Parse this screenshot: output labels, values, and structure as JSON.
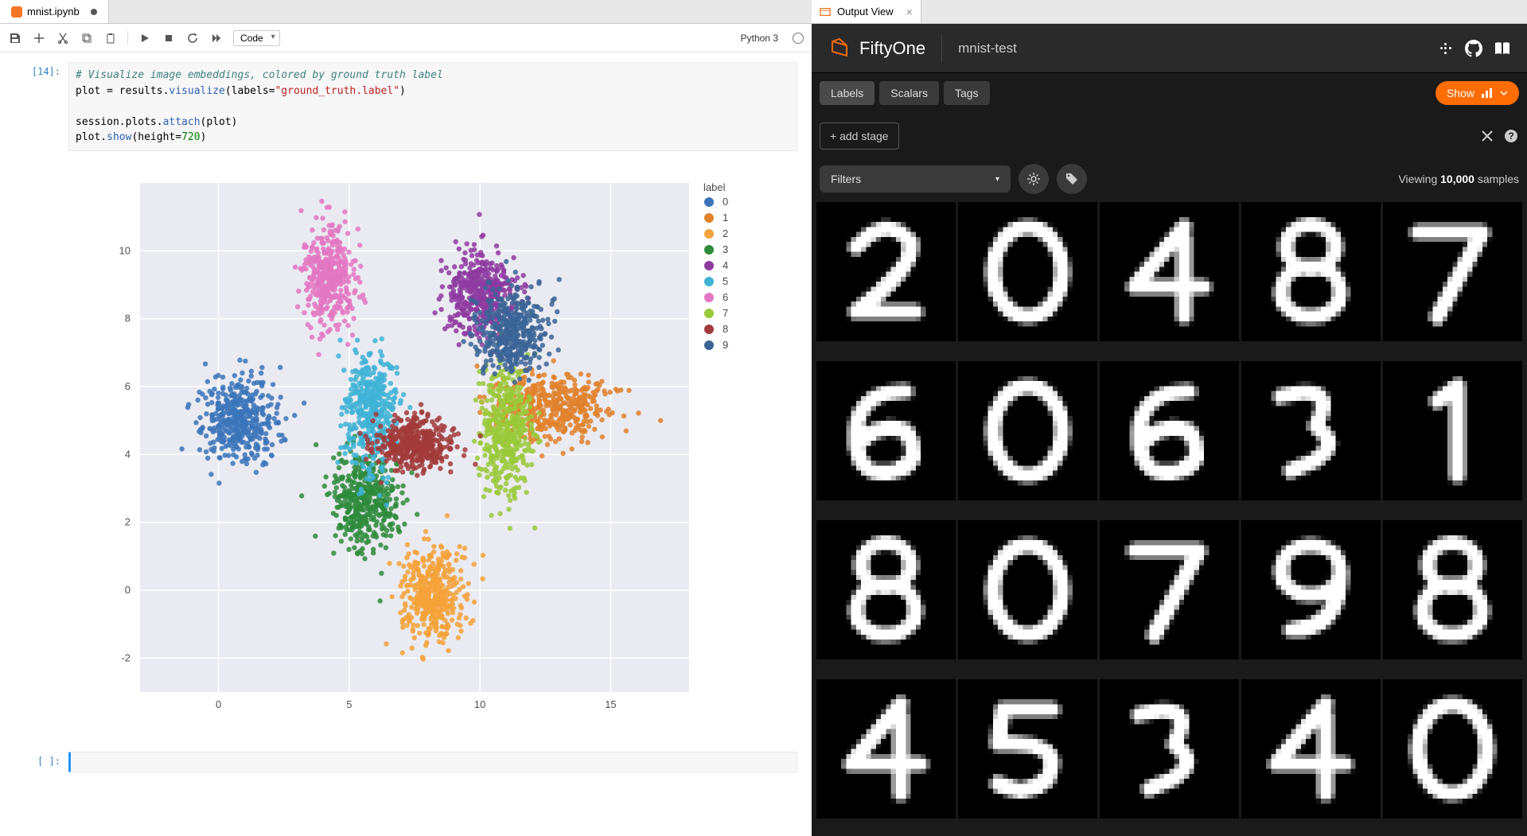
{
  "jupyter": {
    "tab_title": "mnist.ipynb",
    "tab_modified": true,
    "toolbar": {
      "cell_type": "Code",
      "kernel": "Python 3"
    },
    "cells": [
      {
        "prompt_num": "14",
        "code_html": "<span class='c-comm'># Visualize image embeddings, colored by ground truth label</span>\nplot = results.<span class='c-fn'>visualize</span>(labels=<span class='c-str'>\"ground_truth.label\"</span>)\n\nsession.plots.<span class='c-fn'>attach</span>(plot)\nplot.<span class='c-fn'>show</span>(height=<span class='c-num'>720</span>)"
      }
    ],
    "empty_prompt": "[ ]:"
  },
  "output_tab": {
    "title": "Output View"
  },
  "fiftyone": {
    "brand": "FiftyOne",
    "dataset": "mnist-test",
    "tabs": [
      "Labels",
      "Scalars",
      "Tags"
    ],
    "active_tab": 0,
    "show_button": "Show",
    "add_stage": "+ add stage",
    "filters_label": "Filters",
    "viewing_prefix": "Viewing ",
    "viewing_count": "10,000",
    "viewing_suffix": " samples",
    "samples": [
      "2",
      "0",
      "4",
      "8",
      "7",
      "6",
      "0",
      "6",
      "3",
      "1",
      "8",
      "0",
      "7",
      "9",
      "8",
      "4",
      "5",
      "3",
      "4",
      "0"
    ]
  },
  "chart_data": {
    "type": "scatter",
    "title": "",
    "xlabel": "",
    "ylabel": "",
    "xlim": [
      -3,
      18
    ],
    "ylim": [
      -3,
      12
    ],
    "xticks": [
      0,
      5,
      10,
      15
    ],
    "yticks": [
      -2,
      0,
      2,
      4,
      6,
      8,
      10
    ],
    "legend_title": "label",
    "legend_position": "right",
    "grid": true,
    "series": [
      {
        "name": "0",
        "label": "0",
        "color": "#3b74ba",
        "centroid": [
          0.8,
          5.0
        ],
        "spread": [
          1.3,
          1.1
        ],
        "n": 420
      },
      {
        "name": "1",
        "label": "1",
        "color": "#e1812c",
        "centroid": [
          12.8,
          5.4
        ],
        "spread": [
          2.0,
          0.9
        ],
        "n": 420
      },
      {
        "name": "2",
        "label": "2",
        "color": "#f4a23a",
        "centroid": [
          8.2,
          -0.2
        ],
        "spread": [
          1.1,
          1.3
        ],
        "n": 420
      },
      {
        "name": "3",
        "label": "3",
        "color": "#2e8b3c",
        "centroid": [
          5.6,
          2.6
        ],
        "spread": [
          1.1,
          1.3
        ],
        "n": 420
      },
      {
        "name": "4",
        "label": "4",
        "color": "#8e3ba0",
        "centroid": [
          10.0,
          8.7
        ],
        "spread": [
          1.2,
          1.1
        ],
        "n": 420
      },
      {
        "name": "5",
        "label": "5",
        "color": "#3fb3d6",
        "centroid": [
          5.8,
          5.2
        ],
        "spread": [
          0.9,
          1.6
        ],
        "n": 420
      },
      {
        "name": "6",
        "label": "6",
        "color": "#e377c2",
        "centroid": [
          4.2,
          9.2
        ],
        "spread": [
          0.9,
          1.4
        ],
        "n": 420
      },
      {
        "name": "7",
        "label": "7",
        "color": "#9ac93a",
        "centroid": [
          11.0,
          4.7
        ],
        "spread": [
          1.0,
          1.8
        ],
        "n": 420
      },
      {
        "name": "8",
        "label": "8",
        "color": "#a23b3b",
        "centroid": [
          7.5,
          4.3
        ],
        "spread": [
          1.4,
          0.7
        ],
        "n": 420
      },
      {
        "name": "9",
        "label": "9",
        "color": "#3b6496",
        "centroid": [
          11.2,
          7.6
        ],
        "spread": [
          1.2,
          1.1
        ],
        "n": 420
      }
    ]
  }
}
